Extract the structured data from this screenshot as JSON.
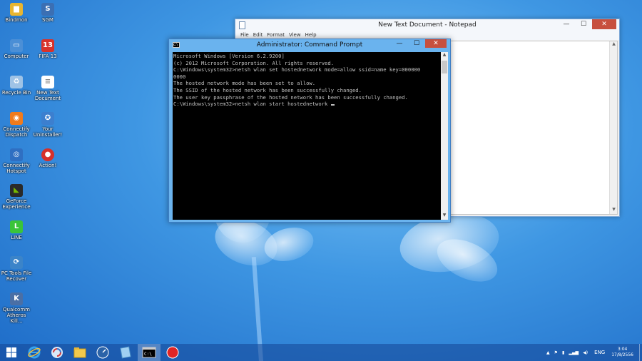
{
  "desktop": {
    "icons": [
      {
        "label": "Bindmon",
        "icon": "folder-icon",
        "color": "#e8b530"
      },
      {
        "label": "SGM",
        "icon": "app-icon",
        "color": "#3b6fb3"
      },
      {
        "label": "Computer",
        "icon": "computer-icon",
        "color": "#4b8fd6"
      },
      {
        "label": "FIFA 13",
        "icon": "game-icon",
        "color": "#d8322a"
      },
      {
        "label": "Recycle Bin",
        "icon": "recycle-bin-icon",
        "color": "#9fc3e6"
      },
      {
        "label": "New Text Document",
        "icon": "text-document-icon",
        "color": "#ffffff"
      },
      {
        "label": "Connectify Dispatch",
        "icon": "connectify-icon",
        "color": "#f07b1c"
      },
      {
        "label": "Your Uninstaller!",
        "icon": "uninstaller-icon",
        "color": "#3c7fcf"
      },
      {
        "label": "Connectify Hotspot",
        "icon": "hotspot-icon",
        "color": "#2f6fc2"
      },
      {
        "label": "Action!",
        "icon": "action-icon",
        "color": "#d6302a"
      },
      {
        "label": "GeForce Experience",
        "icon": "geforce-icon",
        "color": "#76b900"
      },
      {
        "label": "LINE",
        "icon": "line-icon",
        "color": "#3ac43a"
      },
      {
        "label": "PC Tools File Recover",
        "icon": "file-recover-icon",
        "color": "#3b84c9"
      },
      {
        "label": "Qualcomm Atheros Kill...",
        "icon": "qualcomm-icon",
        "color": "#4a6fa5"
      }
    ]
  },
  "notepad": {
    "title": "New Text Document - Notepad",
    "menu": [
      "File",
      "Edit",
      "Format",
      "View",
      "Help"
    ],
    "content": ""
  },
  "cmd": {
    "title": "Administrator: Command Prompt",
    "lines": [
      "Microsoft Windows [Version 6.2.9200]",
      "(c) 2012 Microsoft Corporation. All rights reserved.",
      "",
      "C:\\Windows\\system32>netsh wlan set hostednetwork mode=allow ssid=name key=000000",
      "0000",
      "The hosted network mode has been set to allow.",
      "The SSID of the hosted network has been successfully changed.",
      "The user key passphrase of the hosted network has been successfully changed.",
      "",
      "",
      "C:\\Windows\\system32>netsh wlan start hostednetwork "
    ]
  },
  "window_controls": {
    "minimize": "—",
    "maximize": "☐",
    "close": "✕"
  },
  "taskbar": {
    "items": [
      {
        "name": "start-button",
        "icon": "windows-logo-icon",
        "active": false
      },
      {
        "name": "internet-explorer",
        "icon": "internet-explorer-icon",
        "active": false
      },
      {
        "name": "app-swirl",
        "icon": "swirl-app-icon",
        "active": false
      },
      {
        "name": "file-explorer",
        "icon": "folder-icon",
        "active": false
      },
      {
        "name": "app-gauge",
        "icon": "gauge-icon",
        "active": false
      },
      {
        "name": "app-book",
        "icon": "book-icon",
        "active": false
      },
      {
        "name": "command-prompt",
        "icon": "cmd-icon",
        "active": true
      },
      {
        "name": "action-recorder",
        "icon": "record-icon",
        "active": false
      }
    ],
    "tray": {
      "language": "ENG",
      "time": "3:04",
      "date": "17/8/2556"
    }
  }
}
